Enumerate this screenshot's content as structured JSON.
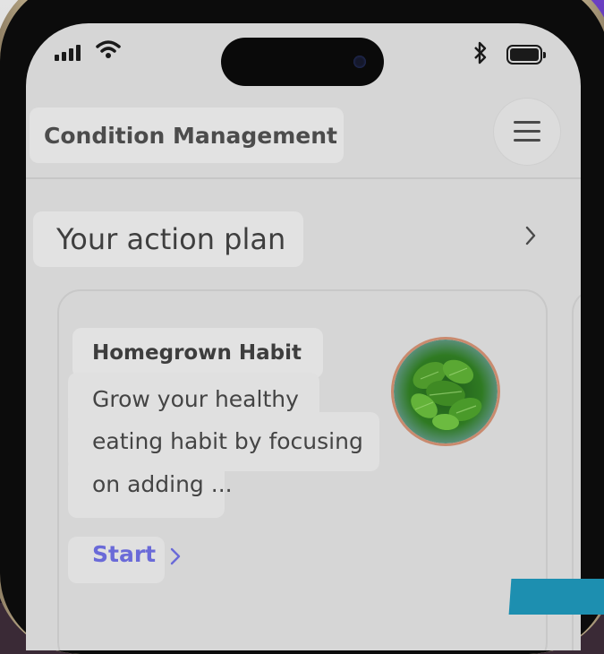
{
  "header": {
    "title": "Condition Management",
    "menu_icon": "hamburger-menu-icon"
  },
  "section": {
    "title": "Your action plan",
    "chevron_icon": "chevron-right-icon"
  },
  "card": {
    "title": "Homegrown Habit",
    "description_lines": [
      "Grow your healthy",
      "eating habit by focusing",
      "on adding ..."
    ],
    "action_label": "Start",
    "image_name": "spinach-bowl-image"
  },
  "colors": {
    "accent": "#6a6ad8",
    "screen_bg": "#d6d6d6",
    "highlight": "#e2e2e2"
  }
}
